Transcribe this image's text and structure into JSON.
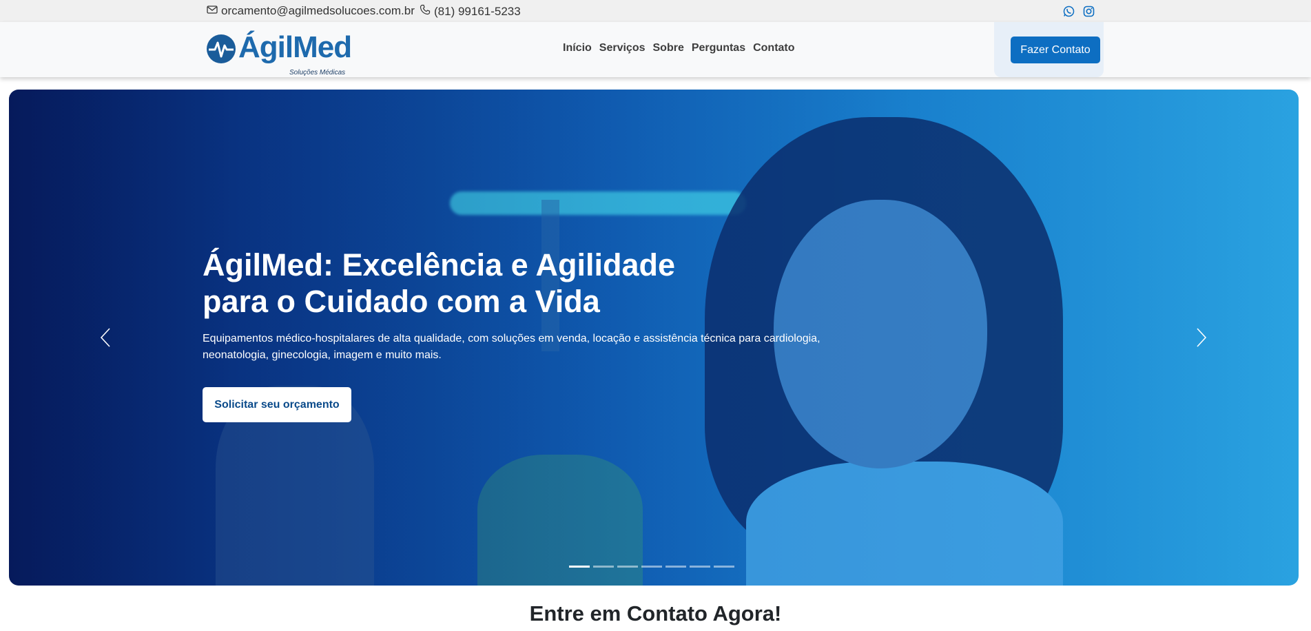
{
  "topbar": {
    "email": "orcamento@agilmedsolucoes.com.br",
    "phone": "(81) 99161-5233",
    "social": [
      "whatsapp-icon",
      "instagram-icon"
    ]
  },
  "header": {
    "logo_brand": "ÁgilMed",
    "logo_tagline": "Soluções Médicas",
    "nav": [
      "Início",
      "Serviços",
      "Sobre",
      "Perguntas",
      "Contato"
    ],
    "cta_label": "Fazer Contato"
  },
  "hero": {
    "title_line1": "ÁgilMed: Excelência e Agilidade",
    "title_line2": "para o Cuidado com a Vida",
    "subtitle": "Equipamentos médico-hospitalares de alta qualidade, com soluções em venda, locação e assistência técnica para cardiologia, neonatologia, ginecologia, imagem e muito mais.",
    "button_label": "Solicitar seu orçamento",
    "slide_count": 7,
    "active_slide": 1
  },
  "section": {
    "title": "Entre em Contato Agora!"
  },
  "colors": {
    "primary": "#0d6ec2",
    "brand_blue": "#1e6aad",
    "topbar_bg": "#f0f0f0"
  }
}
